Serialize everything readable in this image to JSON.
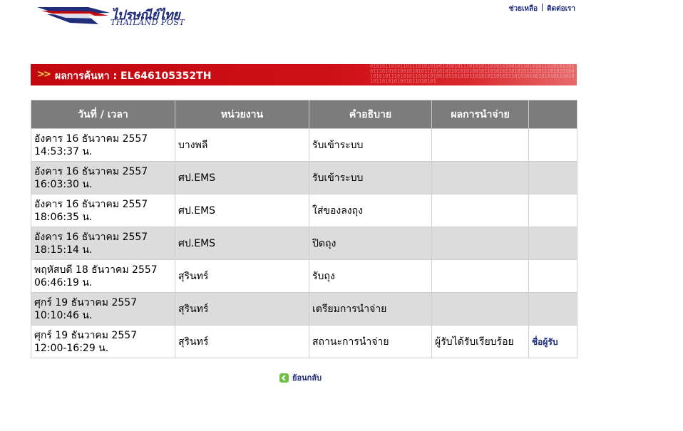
{
  "brand": {
    "name_thai": "ไปรษณีย์ไทย",
    "name_english": "THAILAND POST",
    "colors": {
      "primary": "#1f2d7a",
      "banner_red": "#c2080f",
      "header_gray": "#7c7c7c",
      "row_alt": "#dcdcdc"
    }
  },
  "top_links": {
    "help": "ช่วยเหลือ",
    "contact": "ติดต่อเรา"
  },
  "banner": {
    "arrows": ">>",
    "title": "ผลการค้นหา : EL646105352TH",
    "binary_pattern": "0101011010110111010101001010101110101011010101001011010101101010110101110101010010101011101010110101010010110101011010101101011101010100101010111010101101010100101101010110101011010111010101001010101110101011010101001011010101"
  },
  "table": {
    "headers": [
      "วันที่ / เวลา",
      "หน่วยงาน",
      "คำอธิบาย",
      "ผลการนำจ่าย",
      ""
    ],
    "rows": [
      {
        "date": "อังคาร 16 ธันวาคม 2557",
        "time": "14:53:37 น.",
        "office": "บางพลี",
        "description": "รับเข้าระบบ",
        "result": "",
        "action": ""
      },
      {
        "date": "อังคาร 16 ธันวาคม 2557",
        "time": "16:03:30 น.",
        "office": "ศป.EMS",
        "description": "รับเข้าระบบ",
        "result": "",
        "action": ""
      },
      {
        "date": "อังคาร 16 ธันวาคม 2557",
        "time": "18:06:35 น.",
        "office": "ศป.EMS",
        "description": "ใส่ของลงถุง",
        "result": "",
        "action": ""
      },
      {
        "date": "อังคาร 16 ธันวาคม 2557",
        "time": "18:15:14 น.",
        "office": "ศป.EMS",
        "description": "ปิดถุง",
        "result": "",
        "action": ""
      },
      {
        "date": "พฤหัสบดี 18 ธันวาคม 2557",
        "time": "06:46:19 น.",
        "office": "สุรินทร์",
        "description": "รับถุง",
        "result": "",
        "action": ""
      },
      {
        "date": "ศุกร์ 19 ธันวาคม 2557",
        "time": "10:10:46 น.",
        "office": "สุรินทร์",
        "description": "เตรียมการนำจ่าย",
        "result": "",
        "action": ""
      },
      {
        "date": "ศุกร์ 19 ธันวาคม 2557",
        "time": "12:00-16:29 น.",
        "office": "สุรินทร์",
        "description": "สถานะการนำจ่าย",
        "result": "ผู้รับได้รับเรียบร้อย",
        "action": "ชื่อผู้รับ"
      }
    ]
  },
  "back_link": {
    "label": "ย้อนกลับ",
    "icon": "back-arrow-icon"
  }
}
